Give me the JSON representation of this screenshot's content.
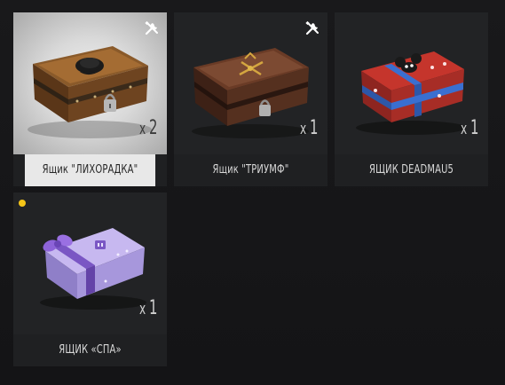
{
  "colors": {
    "new_dot": "#f5c518",
    "tile_bg": "#1f2022",
    "selected_label_bg": "#e8e8e8"
  },
  "items": [
    {
      "label": "Ящик \"ЛИХОРАДКА\"",
      "count_prefix": "x",
      "count": "2",
      "icon": "wrench-screwdriver-icon",
      "selected": true
    },
    {
      "label": "Ящик \"ТРИУМФ\"",
      "count_prefix": "x",
      "count": "1",
      "icon": "wrench-screwdriver-icon",
      "selected": false
    },
    {
      "label": "ЯЩИК DEADMAU5",
      "count_prefix": "x",
      "count": "1",
      "selected": false
    },
    {
      "label": "ЯЩИК «СПА»",
      "count_prefix": "x",
      "count": "1",
      "badge": "new-dot",
      "selected": false
    }
  ]
}
